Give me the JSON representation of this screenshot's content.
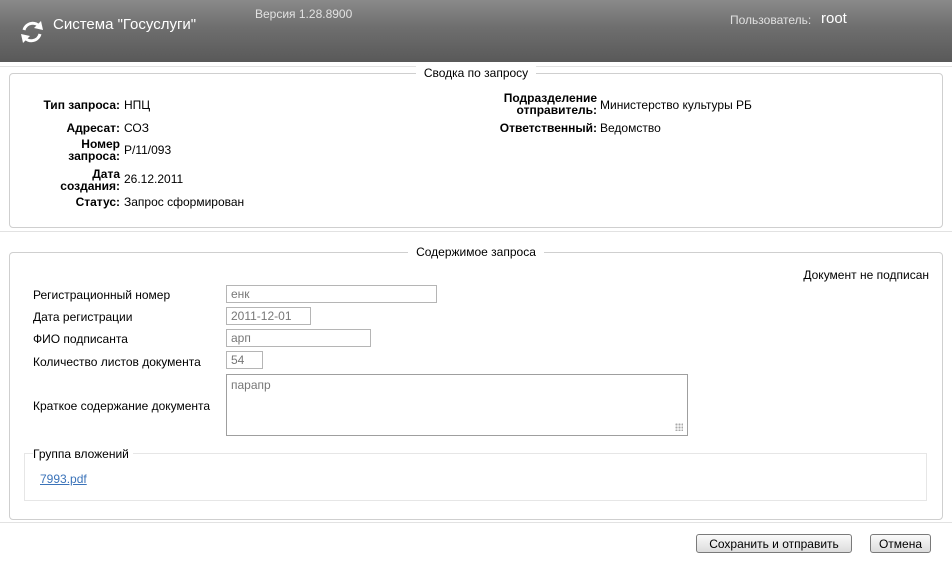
{
  "header": {
    "app_title": "Система \"Госуслуги\"",
    "version": "Версия 1.28.8900",
    "user_label": "Пользователь:",
    "user_name": "root"
  },
  "summary": {
    "title": "Сводка по запросу",
    "request_type_label": "Тип запроса:",
    "request_type": "НПЦ",
    "addressee_label": "Адресат:",
    "addressee": "СОЗ",
    "number_label_1": "Номер",
    "number_label_2": "запроса:",
    "number": "Р/11/093",
    "date_label_1": "Дата",
    "date_label_2": "создания:",
    "date": "26.12.2011",
    "status_label": "Статус:",
    "status": "Запрос сформирован",
    "sender_label_1": "Подразделение",
    "sender_label_2": "отправитель:",
    "sender": "Министерство культуры РБ",
    "responsible_label": "Ответственный:",
    "responsible": "Ведомство"
  },
  "content": {
    "title": "Содержимое запроса",
    "unsigned": "Документ не подписан",
    "reg_number_label": "Регистрационный номер",
    "reg_number": "енк",
    "reg_date_label": "Дата регистрации",
    "reg_date": "2011-12-01",
    "signer_label": "ФИО подписанта",
    "signer": "арп",
    "pages_label": "Количество листов документа",
    "pages": "54",
    "summary_label": "Краткое содержание документа",
    "summary_text": "парапр",
    "attachments_label": "Группа вложений",
    "attachment_file": "7993.pdf"
  },
  "buttons": {
    "save_send": "Сохранить и отправить",
    "cancel": "Отмена"
  }
}
